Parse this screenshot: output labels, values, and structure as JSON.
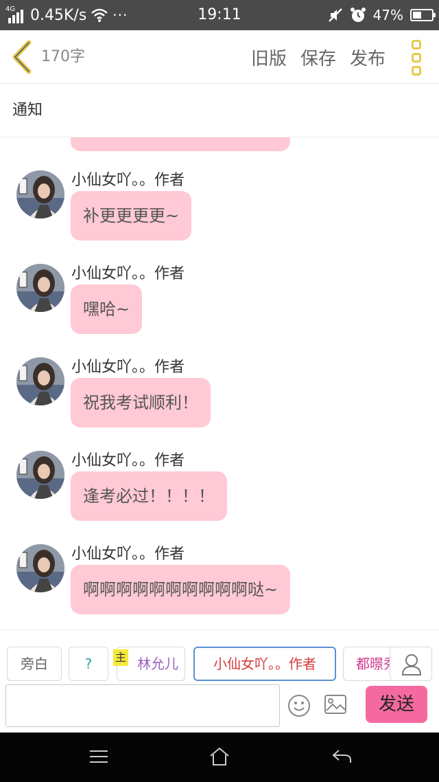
{
  "status_bar": {
    "network_tag": "4G",
    "speed": "0.45K/s",
    "dots": "···",
    "time": "19:11",
    "battery_percent": "47%",
    "battery_level": 0.47
  },
  "header": {
    "word_count": "170字",
    "actions": [
      "旧版",
      "保存",
      "发布"
    ]
  },
  "notice": {
    "label": "通知"
  },
  "messages": [
    {
      "author": "小仙女吖。。作者",
      "text": "补更更更更~"
    },
    {
      "author": "小仙女吖。。作者",
      "text": "嘿哈~"
    },
    {
      "author": "小仙女吖。。作者",
      "text": "祝我考试顺利！"
    },
    {
      "author": "小仙女吖。。作者",
      "text": "逢考必过！！！！"
    },
    {
      "author": "小仙女吖。。作者",
      "text": "啊啊啊啊啊啊啊啊啊啊哒~"
    }
  ],
  "roles": {
    "narration": "旁白",
    "question": "?",
    "main_badge": "主",
    "role1": "林允儿",
    "role2_selected": "小仙女吖。。作者",
    "role3": "都暻秀"
  },
  "composer": {
    "placeholder": "",
    "send_label": "发送"
  },
  "colors": {
    "bubble": "#ffc9d5",
    "send_button": "#f46aa0",
    "menu_accent": "#e6c94a",
    "selected_role_border": "#5b8fd6"
  }
}
